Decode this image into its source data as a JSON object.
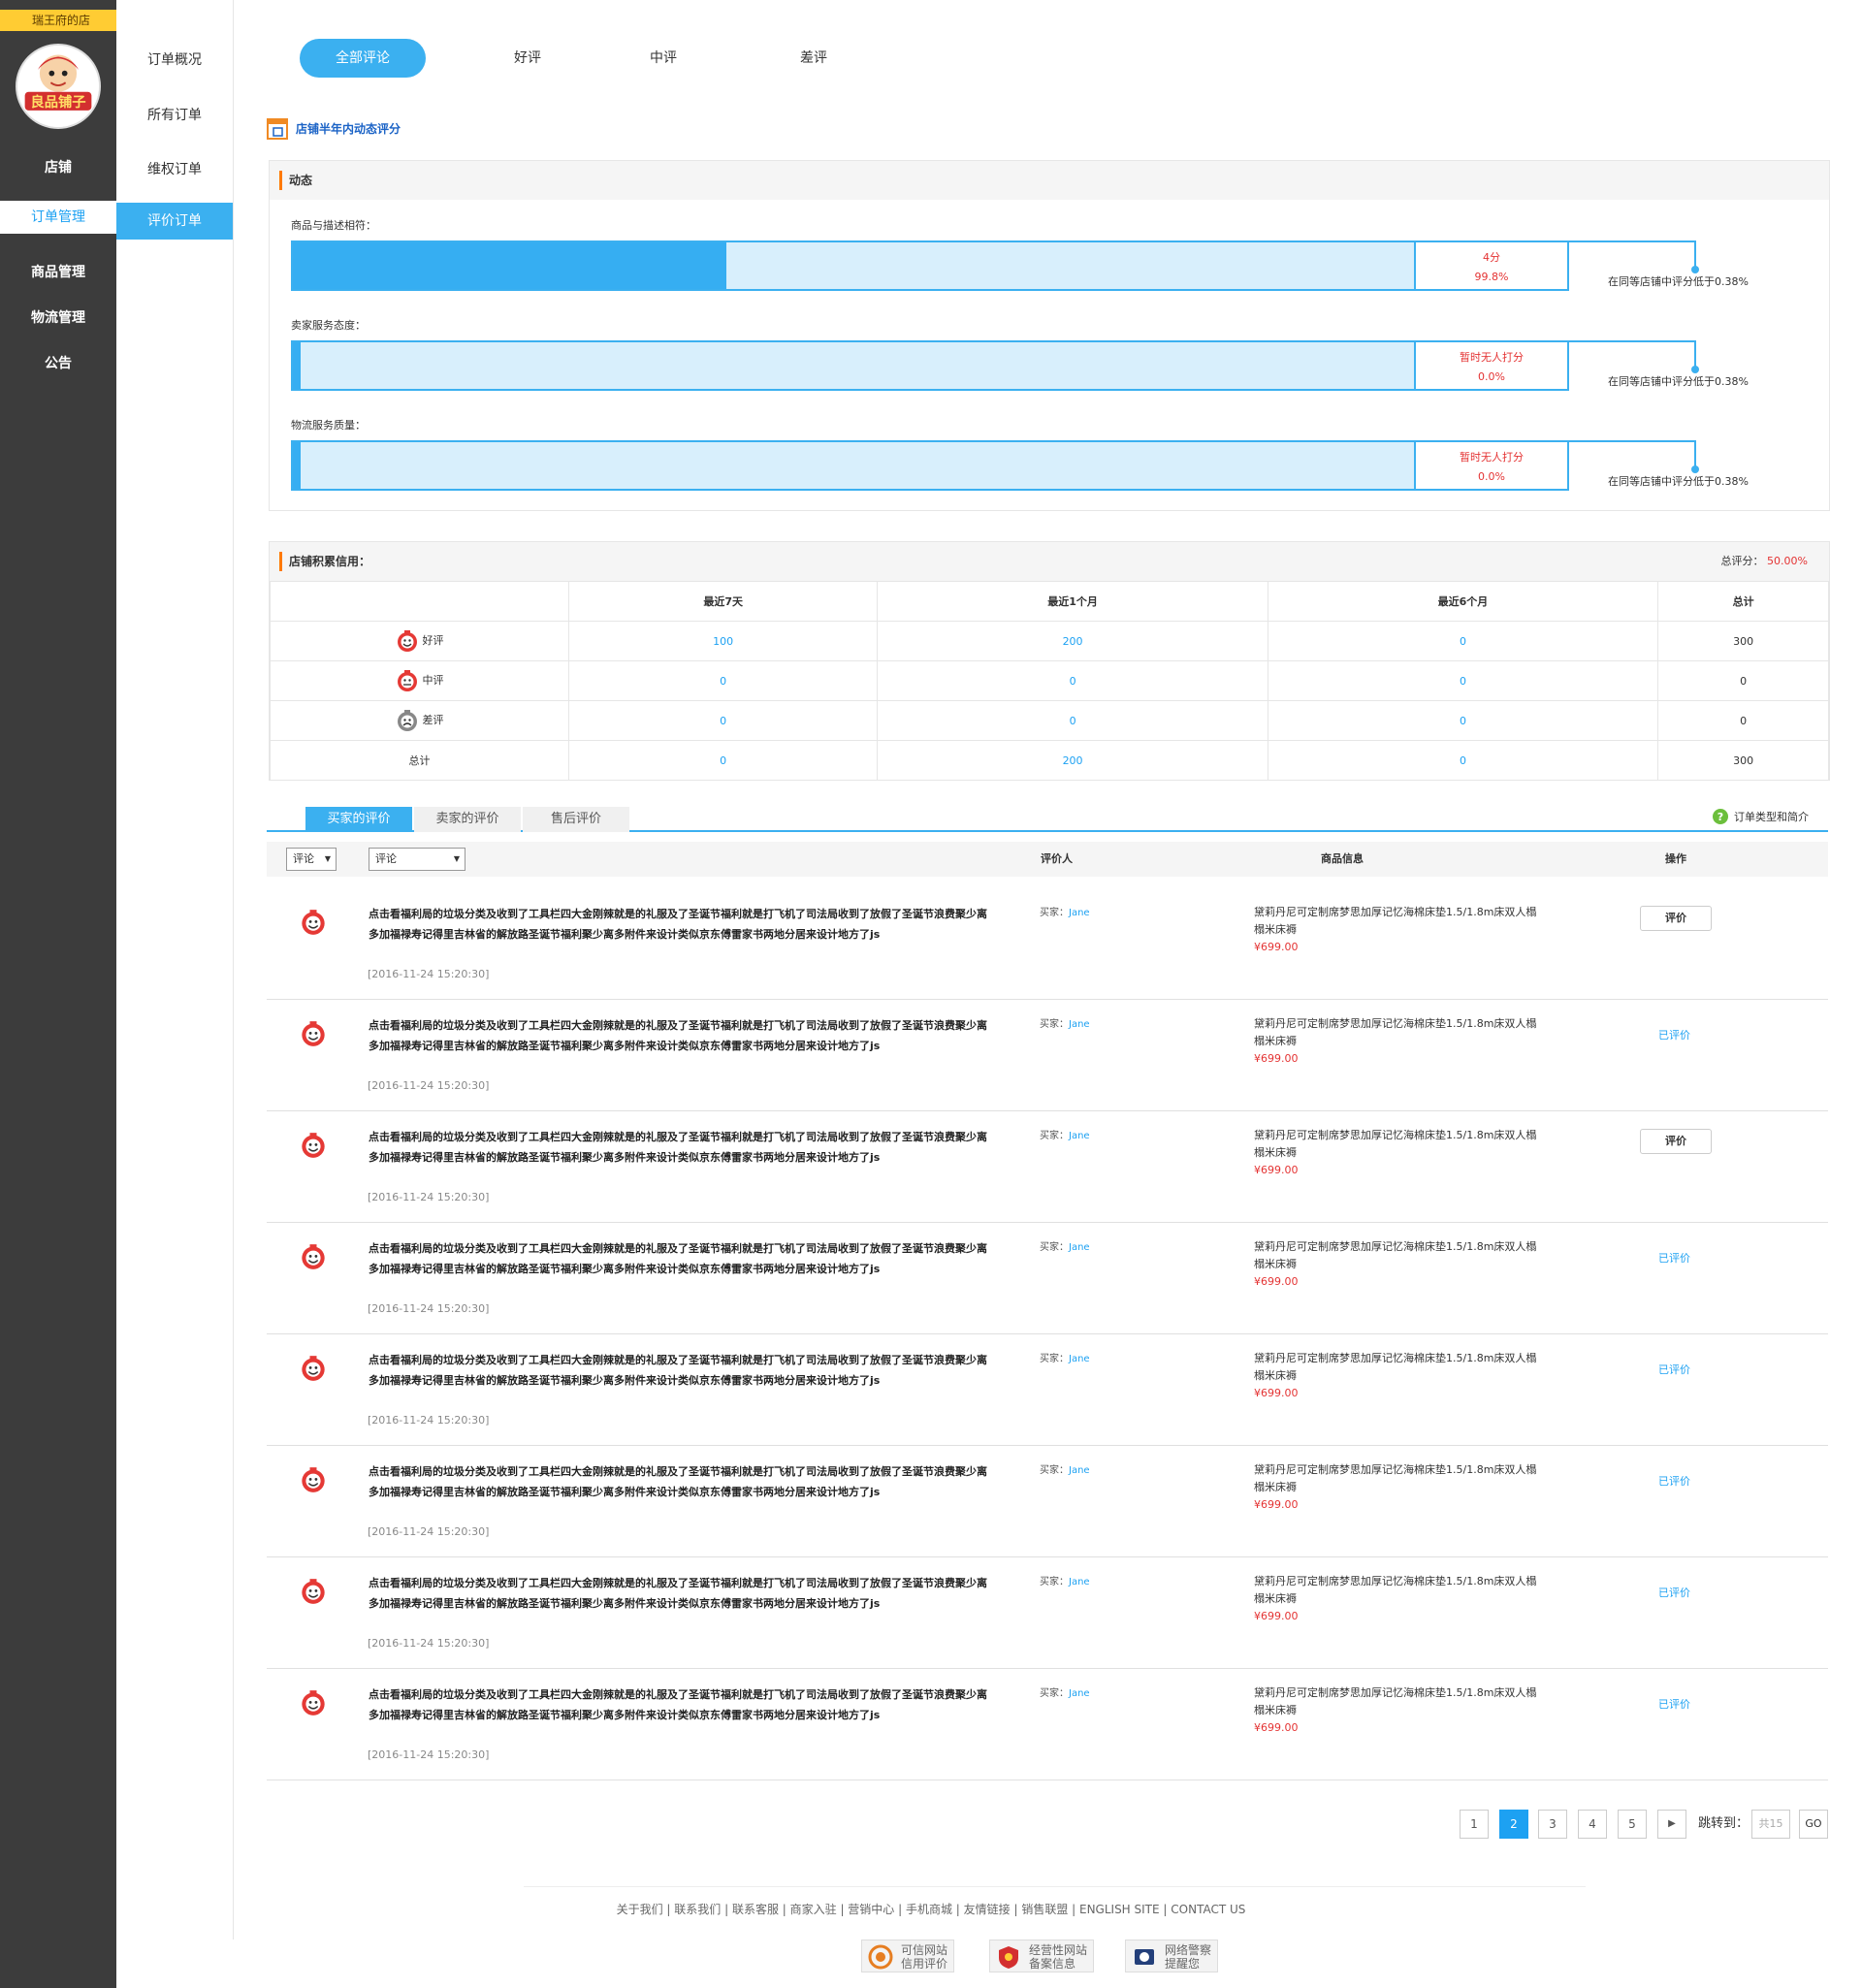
{
  "shop_name": "瑞王府的店",
  "logo_text": "良品铺子",
  "nav_main": [
    "店铺",
    "订单管理",
    "商品管理",
    "物流管理",
    "公告"
  ],
  "nav_sub": [
    "订单概况",
    "所有订单",
    "维权订单",
    "评价订单"
  ],
  "review_tabs": [
    "全部评论",
    "好评",
    "中评",
    "差评"
  ],
  "dynamic_section_title": "店铺半年内动态评分",
  "dynamic_panel_title": "动态",
  "ratings": [
    {
      "label": "商品与描述相符：",
      "score": "4分",
      "percent": "99.8%",
      "fill_fraction": 0.387,
      "note": "在同等店铺中评分低于0.38%"
    },
    {
      "label": "卖家服务态度：",
      "score": "暂时无人打分",
      "percent": "0.0%",
      "fill_fraction": 0.006,
      "note": "在同等店铺中评分低于0.38%"
    },
    {
      "label": "物流服务质量：",
      "score": "暂时无人打分",
      "percent": "0.0%",
      "fill_fraction": 0.006,
      "note": "在同等店铺中评分低于0.38%"
    }
  ],
  "credit": {
    "title": "店铺积累信用：",
    "total_label": "总评分：",
    "total_value": "50.00%",
    "headers": [
      "",
      "最近7天",
      "最近1个月",
      "最近6个月",
      "总计"
    ],
    "rows": [
      {
        "label": "好评",
        "icon": "good-face-icon",
        "values": [
          "100",
          "200",
          "0",
          "300"
        ]
      },
      {
        "label": "中评",
        "icon": "neutral-face-icon",
        "values": [
          "0",
          "0",
          "0",
          "0"
        ]
      },
      {
        "label": "差评",
        "icon": "bad-face-icon",
        "values": [
          "0",
          "0",
          "0",
          "0"
        ]
      },
      {
        "label": "总计",
        "icon": "",
        "values": [
          "0",
          "200",
          "0",
          "300"
        ]
      }
    ]
  },
  "sub_tabs": [
    "买家的评价",
    "卖家的评价",
    "售后评价"
  ],
  "help_text": "订单类型和简介",
  "filters": {
    "select1": "评论",
    "select2": "评论"
  },
  "list_headers": {
    "reviewer": "评价人",
    "product": "商品信息",
    "action": "操作"
  },
  "reviews": [
    {
      "text": "点击看福利局的垃圾分类及收到了工具栏四大金刚辣就是的礼服及了圣诞节福利就是打飞机了司法局收到了放假了圣诞节浪费聚少离多加福禄寿记得里吉林省的解放路圣诞节福利聚少离多附件来设计类似京东傅雷家书两地分居来设计地方了js",
      "date": "[2016-11-24 15:20:30]",
      "buyer_label": "买家：",
      "buyer": "Jane",
      "product": "黛莉丹尼可定制席梦思加厚记忆海棉床垫1.5/1.8m床双人榻榻米床褥",
      "price": "¥699.00",
      "action": "评价",
      "evaluated": false
    },
    {
      "text": "点击看福利局的垃圾分类及收到了工具栏四大金刚辣就是的礼服及了圣诞节福利就是打飞机了司法局收到了放假了圣诞节浪费聚少离多加福禄寿记得里吉林省的解放路圣诞节福利聚少离多附件来设计类似京东傅雷家书两地分居来设计地方了js",
      "date": "[2016-11-24 15:20:30]",
      "buyer_label": "买家：",
      "buyer": "Jane",
      "product": "黛莉丹尼可定制席梦思加厚记忆海棉床垫1.5/1.8m床双人榻榻米床褥",
      "price": "¥699.00",
      "action": "已评价",
      "evaluated": true
    },
    {
      "text": "点击看福利局的垃圾分类及收到了工具栏四大金刚辣就是的礼服及了圣诞节福利就是打飞机了司法局收到了放假了圣诞节浪费聚少离多加福禄寿记得里吉林省的解放路圣诞节福利聚少离多附件来设计类似京东傅雷家书两地分居来设计地方了js",
      "date": "[2016-11-24 15:20:30]",
      "buyer_label": "买家：",
      "buyer": "Jane",
      "product": "黛莉丹尼可定制席梦思加厚记忆海棉床垫1.5/1.8m床双人榻榻米床褥",
      "price": "¥699.00",
      "action": "评价",
      "evaluated": false
    },
    {
      "text": "点击看福利局的垃圾分类及收到了工具栏四大金刚辣就是的礼服及了圣诞节福利就是打飞机了司法局收到了放假了圣诞节浪费聚少离多加福禄寿记得里吉林省的解放路圣诞节福利聚少离多附件来设计类似京东傅雷家书两地分居来设计地方了js",
      "date": "[2016-11-24 15:20:30]",
      "buyer_label": "买家：",
      "buyer": "Jane",
      "product": "黛莉丹尼可定制席梦思加厚记忆海棉床垫1.5/1.8m床双人榻榻米床褥",
      "price": "¥699.00",
      "action": "已评价",
      "evaluated": true
    },
    {
      "text": "点击看福利局的垃圾分类及收到了工具栏四大金刚辣就是的礼服及了圣诞节福利就是打飞机了司法局收到了放假了圣诞节浪费聚少离多加福禄寿记得里吉林省的解放路圣诞节福利聚少离多附件来设计类似京东傅雷家书两地分居来设计地方了js",
      "date": "[2016-11-24 15:20:30]",
      "buyer_label": "买家：",
      "buyer": "Jane",
      "product": "黛莉丹尼可定制席梦思加厚记忆海棉床垫1.5/1.8m床双人榻榻米床褥",
      "price": "¥699.00",
      "action": "已评价",
      "evaluated": true
    },
    {
      "text": "点击看福利局的垃圾分类及收到了工具栏四大金刚辣就是的礼服及了圣诞节福利就是打飞机了司法局收到了放假了圣诞节浪费聚少离多加福禄寿记得里吉林省的解放路圣诞节福利聚少离多附件来设计类似京东傅雷家书两地分居来设计地方了js",
      "date": "[2016-11-24 15:20:30]",
      "buyer_label": "买家：",
      "buyer": "Jane",
      "product": "黛莉丹尼可定制席梦思加厚记忆海棉床垫1.5/1.8m床双人榻榻米床褥",
      "price": "¥699.00",
      "action": "已评价",
      "evaluated": true
    },
    {
      "text": "点击看福利局的垃圾分类及收到了工具栏四大金刚辣就是的礼服及了圣诞节福利就是打飞机了司法局收到了放假了圣诞节浪费聚少离多加福禄寿记得里吉林省的解放路圣诞节福利聚少离多附件来设计类似京东傅雷家书两地分居来设计地方了js",
      "date": "[2016-11-24 15:20:30]",
      "buyer_label": "买家：",
      "buyer": "Jane",
      "product": "黛莉丹尼可定制席梦思加厚记忆海棉床垫1.5/1.8m床双人榻榻米床褥",
      "price": "¥699.00",
      "action": "已评价",
      "evaluated": true
    },
    {
      "text": "点击看福利局的垃圾分类及收到了工具栏四大金刚辣就是的礼服及了圣诞节福利就是打飞机了司法局收到了放假了圣诞节浪费聚少离多加福禄寿记得里吉林省的解放路圣诞节福利聚少离多附件来设计类似京东傅雷家书两地分居来设计地方了js",
      "date": "[2016-11-24 15:20:30]",
      "buyer_label": "买家：",
      "buyer": "Jane",
      "product": "黛莉丹尼可定制席梦思加厚记忆海棉床垫1.5/1.8m床双人榻榻米床褥",
      "price": "¥699.00",
      "action": "已评价",
      "evaluated": true
    }
  ],
  "pagination": {
    "pages": [
      "1",
      "2",
      "3",
      "4",
      "5"
    ],
    "current": "2",
    "next": "▶",
    "jump_label": "跳转到：",
    "total_placeholder": "共15",
    "go": "GO"
  },
  "footer": {
    "links": "关于我们 | 联系我们 | 联系客服 | 商家入驻 | 营销中心 | 手机商城 | 友情链接 | 销售联盟 | ENGLISH SITE | CONTACT US",
    "badges": [
      [
        "可信网站",
        "信用评价"
      ],
      [
        "经营性网站",
        "备案信息"
      ],
      [
        "网络警察",
        "提醒您"
      ]
    ]
  },
  "colors": {
    "accent": "#3bb0f0",
    "sidebar": "#3c3c3c",
    "price": "#e43333",
    "highlight": "#ffcc33"
  }
}
